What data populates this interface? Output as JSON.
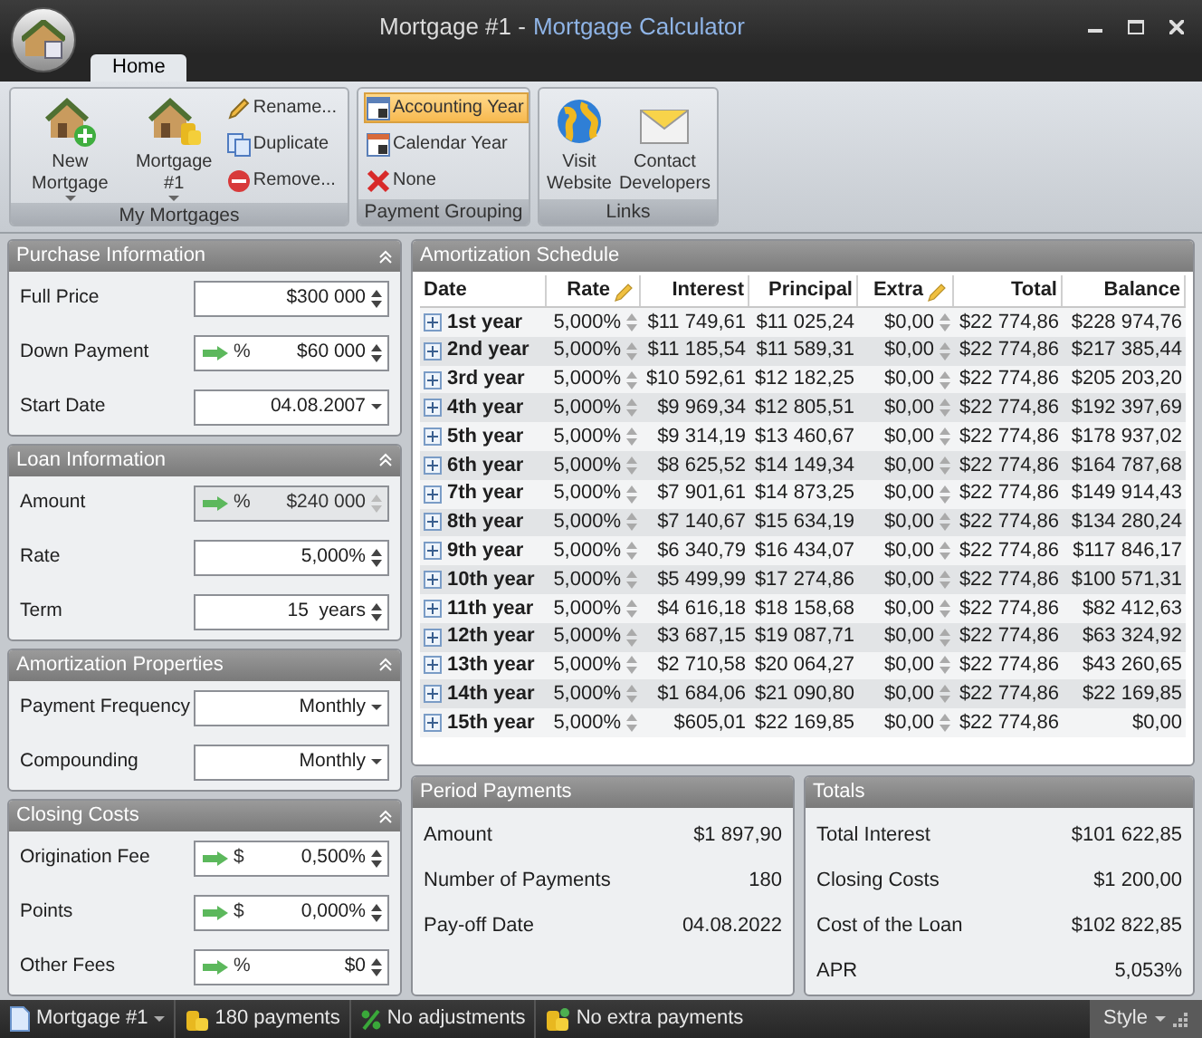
{
  "window": {
    "title": "Mortgage #1 -",
    "app_name": "Mortgage Calculator"
  },
  "tabs": [
    {
      "label": "Home",
      "selected": true
    }
  ],
  "ribbon": {
    "groups": [
      {
        "label": "My Mortgages",
        "large": [
          {
            "label": "New Mortgage",
            "has_menu": true
          },
          {
            "label": "Mortgage #1",
            "has_menu": true
          }
        ],
        "small": [
          {
            "label": "Rename...",
            "selected": false
          },
          {
            "label": "Duplicate",
            "selected": false
          },
          {
            "label": "Remove...",
            "selected": false
          }
        ]
      },
      {
        "label": "Payment Grouping",
        "small": [
          {
            "label": "Accounting Year",
            "selected": true
          },
          {
            "label": "Calendar Year",
            "selected": false
          },
          {
            "label": "None",
            "selected": false
          }
        ]
      },
      {
        "label": "Links",
        "large": [
          {
            "label": "Visit Website",
            "has_menu": false
          },
          {
            "label": "Contact Developers",
            "has_menu": false
          }
        ]
      }
    ]
  },
  "sections": [
    {
      "title": "Purchase Information",
      "fields": [
        {
          "label": "Full Price",
          "kind": "spin",
          "value": "$300 000",
          "disabled": false
        },
        {
          "label": "Down Payment",
          "kind": "spin",
          "mode": "%",
          "value": "$60 000",
          "disabled": false
        },
        {
          "label": "Start Date",
          "kind": "dropdown",
          "value": "04.08.2007",
          "disabled": false
        }
      ]
    },
    {
      "title": "Loan Information",
      "fields": [
        {
          "label": "Amount",
          "kind": "spin",
          "mode": "%",
          "value": "$240 000",
          "disabled": true
        },
        {
          "label": "Rate",
          "kind": "spin",
          "value": "5,000%",
          "disabled": false
        },
        {
          "label": "Term",
          "kind": "spin",
          "value": "15  years",
          "disabled": false
        }
      ]
    },
    {
      "title": "Amortization Properties",
      "fields": [
        {
          "label": "Payment Frequency",
          "kind": "dropdown",
          "value": "Monthly",
          "disabled": false
        },
        {
          "label": "Compounding",
          "kind": "dropdown",
          "value": "Monthly",
          "disabled": false
        }
      ]
    },
    {
      "title": "Closing Costs",
      "fields": [
        {
          "label": "Origination Fee",
          "kind": "spin",
          "mode": "$",
          "value": "0,500%",
          "disabled": false
        },
        {
          "label": "Points",
          "kind": "spin",
          "mode": "$",
          "value": "0,000%",
          "disabled": false
        },
        {
          "label": "Other Fees",
          "kind": "spin",
          "mode": "%",
          "value": "$0",
          "disabled": false
        }
      ]
    }
  ],
  "schedule": {
    "title": "Amortization Schedule",
    "columns": [
      {
        "label": "Date",
        "editable": false
      },
      {
        "label": "Rate",
        "editable": true
      },
      {
        "label": "Interest",
        "editable": false
      },
      {
        "label": "Principal",
        "editable": false
      },
      {
        "label": "Extra",
        "editable": true
      },
      {
        "label": "Total",
        "editable": false
      },
      {
        "label": "Balance",
        "editable": false
      }
    ],
    "rows": [
      {
        "expanded": false,
        "cells": [
          "1st year",
          "5,000%",
          "$11 749,61",
          "$11 025,24",
          "$0,00",
          "$22 774,86",
          "$228 974,76"
        ]
      },
      {
        "expanded": false,
        "cells": [
          "2nd year",
          "5,000%",
          "$11 185,54",
          "$11 589,31",
          "$0,00",
          "$22 774,86",
          "$217 385,44"
        ]
      },
      {
        "expanded": false,
        "cells": [
          "3rd year",
          "5,000%",
          "$10 592,61",
          "$12 182,25",
          "$0,00",
          "$22 774,86",
          "$205 203,20"
        ]
      },
      {
        "expanded": false,
        "cells": [
          "4th year",
          "5,000%",
          "$9 969,34",
          "$12 805,51",
          "$0,00",
          "$22 774,86",
          "$192 397,69"
        ]
      },
      {
        "expanded": false,
        "cells": [
          "5th year",
          "5,000%",
          "$9 314,19",
          "$13 460,67",
          "$0,00",
          "$22 774,86",
          "$178 937,02"
        ]
      },
      {
        "expanded": false,
        "cells": [
          "6th year",
          "5,000%",
          "$8 625,52",
          "$14 149,34",
          "$0,00",
          "$22 774,86",
          "$164 787,68"
        ]
      },
      {
        "expanded": false,
        "cells": [
          "7th year",
          "5,000%",
          "$7 901,61",
          "$14 873,25",
          "$0,00",
          "$22 774,86",
          "$149 914,43"
        ]
      },
      {
        "expanded": false,
        "cells": [
          "8th year",
          "5,000%",
          "$7 140,67",
          "$15 634,19",
          "$0,00",
          "$22 774,86",
          "$134 280,24"
        ]
      },
      {
        "expanded": false,
        "cells": [
          "9th year",
          "5,000%",
          "$6 340,79",
          "$16 434,07",
          "$0,00",
          "$22 774,86",
          "$117 846,17"
        ]
      },
      {
        "expanded": false,
        "cells": [
          "10th year",
          "5,000%",
          "$5 499,99",
          "$17 274,86",
          "$0,00",
          "$22 774,86",
          "$100 571,31"
        ]
      },
      {
        "expanded": false,
        "cells": [
          "11th year",
          "5,000%",
          "$4 616,18",
          "$18 158,68",
          "$0,00",
          "$22 774,86",
          "$82 412,63"
        ]
      },
      {
        "expanded": false,
        "cells": [
          "12th year",
          "5,000%",
          "$3 687,15",
          "$19 087,71",
          "$0,00",
          "$22 774,86",
          "$63 324,92"
        ]
      },
      {
        "expanded": false,
        "cells": [
          "13th year",
          "5,000%",
          "$2 710,58",
          "$20 064,27",
          "$0,00",
          "$22 774,86",
          "$43 260,65"
        ]
      },
      {
        "expanded": false,
        "cells": [
          "14th year",
          "5,000%",
          "$1 684,06",
          "$21 090,80",
          "$0,00",
          "$22 774,86",
          "$22 169,85"
        ]
      },
      {
        "expanded": false,
        "cells": [
          "15th year",
          "5,000%",
          "$605,01",
          "$22 169,85",
          "$0,00",
          "$22 774,86",
          "$0,00"
        ]
      }
    ]
  },
  "summaries": [
    {
      "title": "Period Payments",
      "rows": [
        {
          "label": "Amount",
          "value": "$1 897,90"
        },
        {
          "label": "Number of Payments",
          "value": "180"
        },
        {
          "label": "Pay-off Date",
          "value": "04.08.2022"
        }
      ]
    },
    {
      "title": "Totals",
      "rows": [
        {
          "label": "Total Interest",
          "value": "$101 622,85"
        },
        {
          "label": "Closing Costs",
          "value": "$1 200,00"
        },
        {
          "label": "Cost of the Loan",
          "value": "$102 822,85"
        },
        {
          "label": "APR",
          "value": "5,053%"
        }
      ]
    }
  ],
  "status_bar": {
    "items": [
      {
        "label": "Mortgage #1",
        "has_menu": true
      },
      {
        "label": "180 payments",
        "has_menu": false
      },
      {
        "label": "No adjustments",
        "has_menu": false
      },
      {
        "label": "No extra payments",
        "has_menu": false
      }
    ],
    "style_button": "Style"
  }
}
